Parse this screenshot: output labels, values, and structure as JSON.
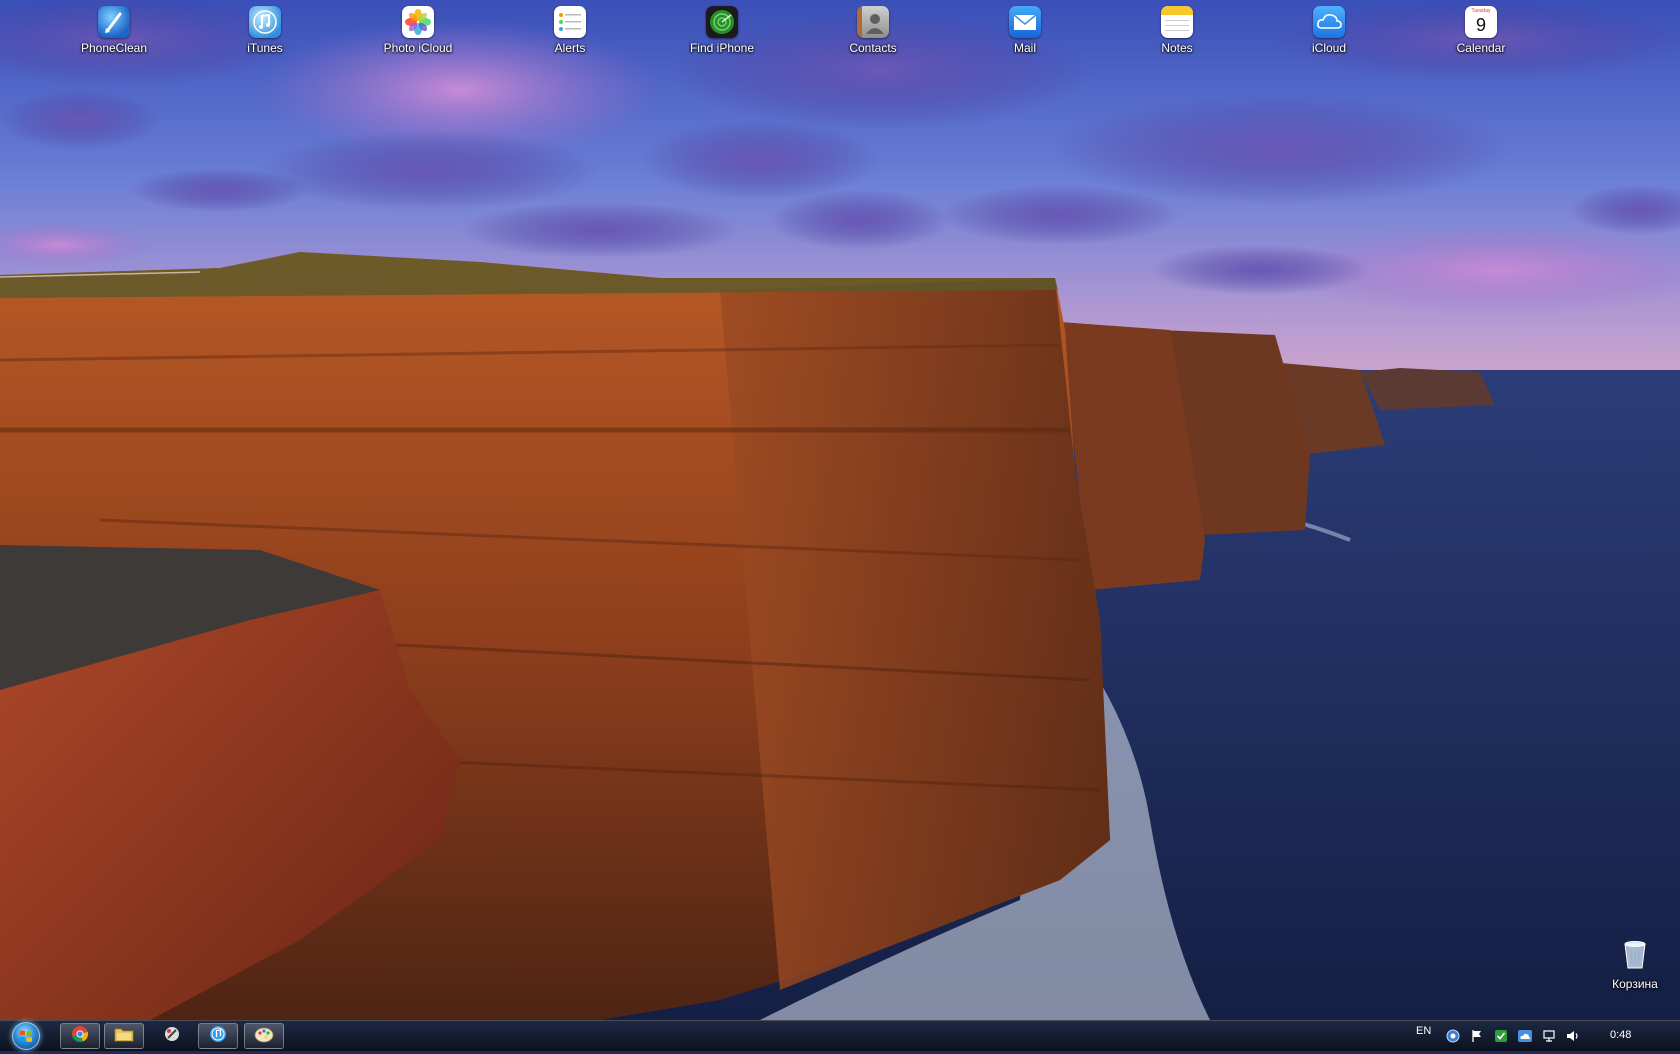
{
  "desktop": {
    "icons": [
      {
        "label": "PhoneClean",
        "icon": "phoneclean-icon"
      },
      {
        "label": "iTunes",
        "icon": "itunes-icon"
      },
      {
        "label": "Photo iCloud",
        "icon": "photos-icon"
      },
      {
        "label": "Alerts",
        "icon": "reminders-list-icon"
      },
      {
        "label": "Find iPhone",
        "icon": "find-iphone-radar-icon"
      },
      {
        "label": "Contacts",
        "icon": "contacts-icon"
      },
      {
        "label": "Mail",
        "icon": "mail-envelope-icon"
      },
      {
        "label": "Notes",
        "icon": "notes-icon"
      },
      {
        "label": "iCloud",
        "icon": "icloud-cloud-icon"
      },
      {
        "label": "Calendar",
        "icon": "calendar-icon",
        "day_header": "Tuesday",
        "day_number": "9"
      }
    ],
    "recycle_bin": {
      "label": "Корзина",
      "icon": "recycle-bin-icon"
    }
  },
  "taskbar": {
    "start_icon": "windows-start-orb-icon",
    "pinned": [
      {
        "icon": "chrome-icon"
      },
      {
        "icon": "file-explorer-icon"
      },
      {
        "icon": "phoneclean-taskbar-icon"
      },
      {
        "icon": "itunes-taskbar-icon"
      },
      {
        "icon": "paint-icon"
      }
    ],
    "language": "EN",
    "tray": [
      {
        "icon": "help-tray-icon"
      },
      {
        "icon": "action-center-flag-icon"
      },
      {
        "icon": "sync-check-icon"
      },
      {
        "icon": "icloud-tray-icon"
      },
      {
        "icon": "network-icon"
      },
      {
        "icon": "volume-icon"
      }
    ],
    "clock": "0:48"
  },
  "colors": {
    "sky_top": "#2f3f9e",
    "cliff": "#a2451e",
    "sea": "#1c2b57",
    "taskbar": "#0f1626"
  }
}
